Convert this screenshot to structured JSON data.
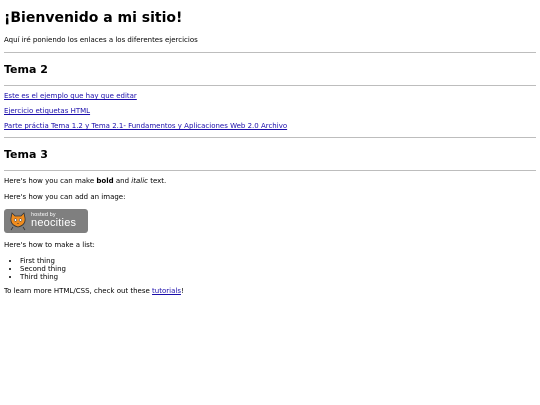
{
  "page": {
    "title": "¡Bienvenido a mi sitio!",
    "intro": "Aquí iré poniendo los enlaces a los diferentes ejercicios"
  },
  "tema2": {
    "heading": "Tema 2",
    "links": [
      "Este es el ejemplo que hay que editar",
      "Ejercicio etiquetas HTML",
      "Parte práctia Tema 1.2 y Tema 2.1- Fundamentos y Aplicaciones Web 2.0 Archivo"
    ]
  },
  "tema3": {
    "heading": "Tema 3",
    "line1_pre": "Here's how you can make ",
    "line1_bold": "bold",
    "line1_mid": " and ",
    "line1_italic": "italic",
    "line1_post": " text.",
    "image_intro": "Here's how you can add an image:",
    "badge_small": "hosted by",
    "badge_big": "neocities",
    "list_intro": "Here's how to make a list:",
    "list": [
      "First thing",
      "Second thing",
      "Third thing"
    ],
    "learn_pre": "To learn more HTML/CSS, check out these ",
    "learn_link": "tutorials",
    "learn_post": "!"
  },
  "colors": {
    "link": "#1a0dab",
    "rule": "#bdbdbd",
    "badge_bg": "#7f7f7f",
    "cat": "#f08c1e"
  },
  "icons": {
    "badge_logo": "neocities-cat-icon"
  }
}
